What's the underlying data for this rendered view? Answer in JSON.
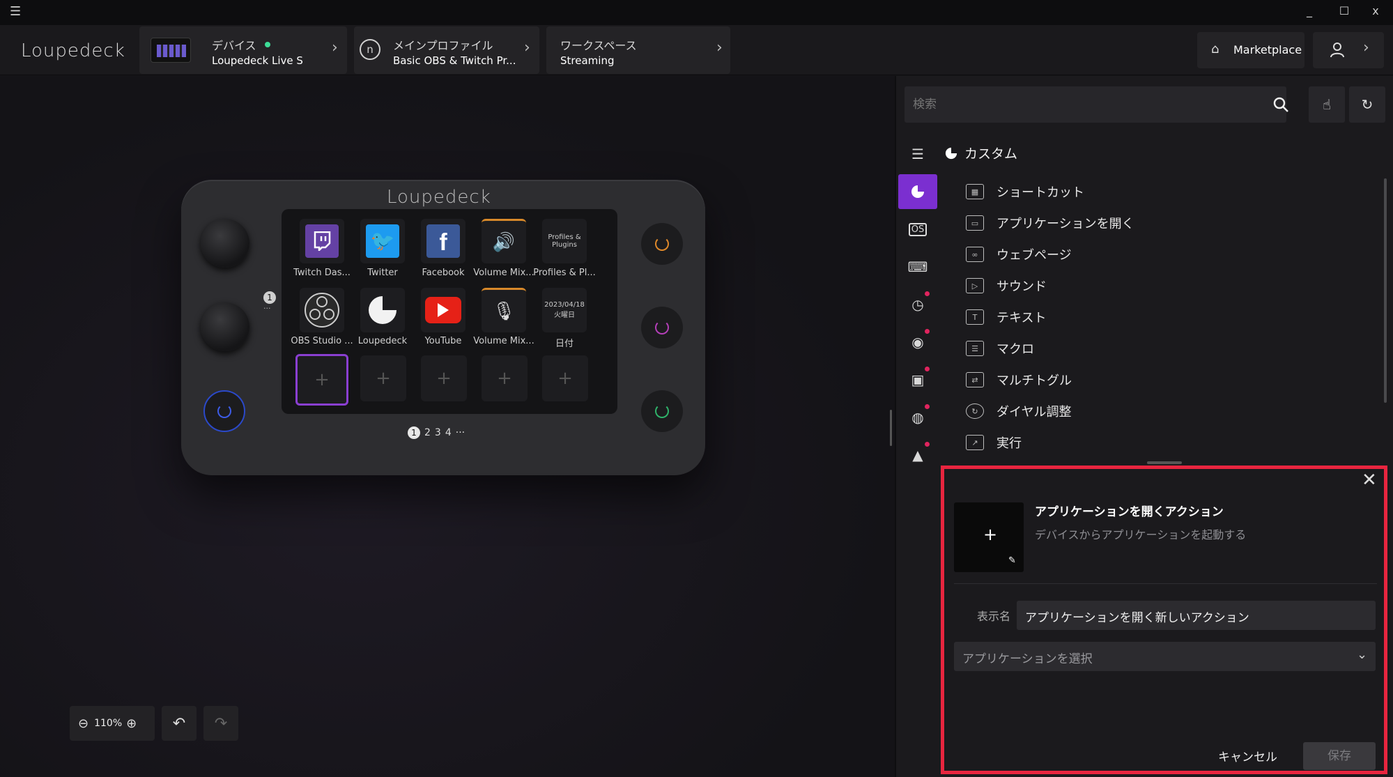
{
  "titlebar": {
    "menu_icon": "☰",
    "minimize": "_",
    "maximize": "☐",
    "close": "x"
  },
  "header": {
    "logo": "Loupedeck",
    "device": {
      "label": "デバイス",
      "value": "Loupedeck Live S"
    },
    "profile": {
      "label": "メインプロファイル",
      "value": "Basic OBS & Twitch Pr..."
    },
    "workspace": {
      "label": "ワークスペース",
      "value": "Streaming"
    },
    "marketplace_label": "Marketplace"
  },
  "device": {
    "brand": "Loupedeck",
    "tiles_row1": [
      {
        "label": "Twitch Das...",
        "icon": "twitch-icon"
      },
      {
        "label": "Twitter",
        "icon": "twitter-icon"
      },
      {
        "label": "Facebook",
        "icon": "facebook-icon"
      },
      {
        "label": "Volume Mix...",
        "icon": "speaker-icon"
      },
      {
        "label": "Profiles & Pl...",
        "icon": "profiles-plugins-icon",
        "text": "Profiles & Plugins"
      }
    ],
    "tiles_row2": [
      {
        "label": "OBS Studio ...",
        "icon": "obs-icon"
      },
      {
        "label": "Loupedeck",
        "icon": "loupedeck-icon"
      },
      {
        "label": "YouTube",
        "icon": "youtube-icon"
      },
      {
        "label": "Volume Mix...",
        "icon": "microphone-icon"
      },
      {
        "label": "日付",
        "icon": "date-icon",
        "date": "2023/04/18",
        "weekday": "火曜日"
      }
    ],
    "pages": [
      "1",
      "2",
      "3",
      "4",
      "···"
    ],
    "side_indicator": "1",
    "side_dots": "···"
  },
  "zoom": {
    "value": "110%"
  },
  "search": {
    "placeholder": "検索"
  },
  "category": {
    "title": "カスタム"
  },
  "actions": [
    "ショートカット",
    "アプリケーションを開く",
    "ウェブページ",
    "サウンド",
    "テキスト",
    "マクロ",
    "マルチトグル",
    "ダイヤル調整",
    "実行"
  ],
  "dialog": {
    "title": "アプリケーションを開くアクション",
    "subtitle": "デバイスからアプリケーションを起動する",
    "name_label": "表示名",
    "name_value": "アプリケーションを開く新しいアクション",
    "app_placeholder": "アプリケーションを選択",
    "cancel": "キャンセル",
    "save": "保存",
    "icon_plus": "+"
  },
  "colors": {
    "accent": "#7b2fd0",
    "highlight": "#e8253f",
    "status_green": "#3ddc97"
  }
}
